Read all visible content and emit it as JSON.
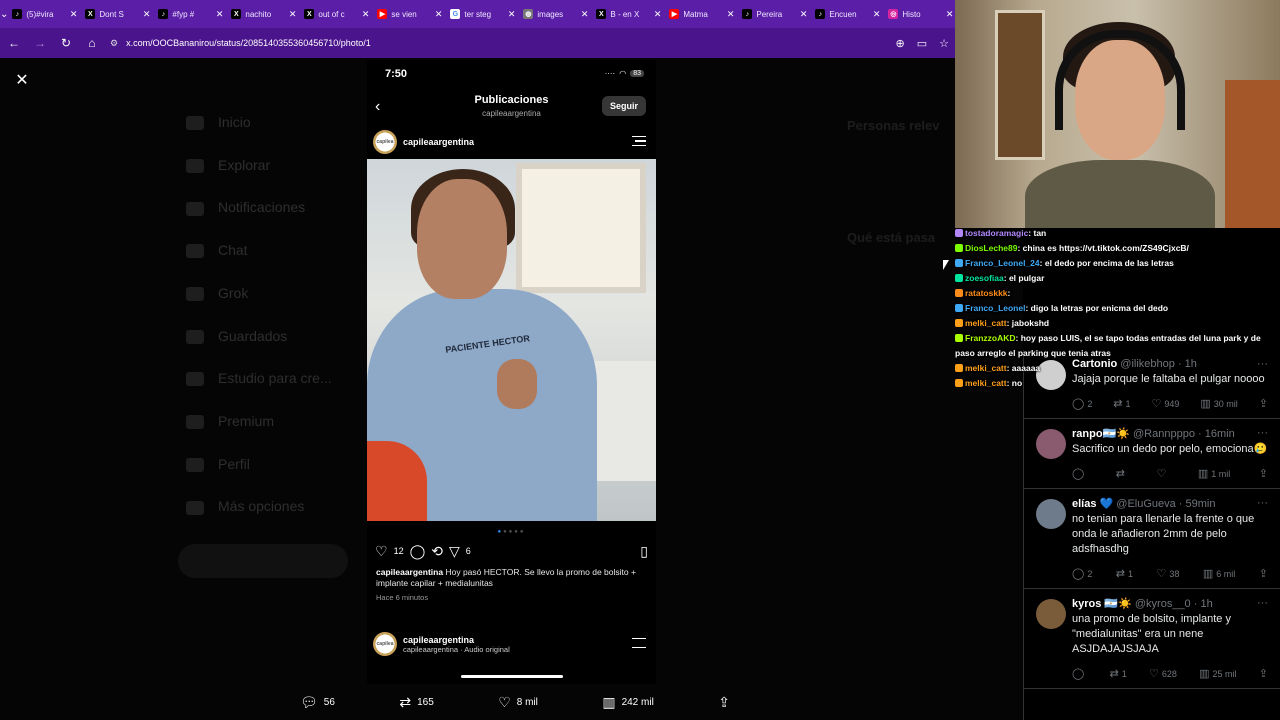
{
  "browser": {
    "tabs": [
      {
        "title": "(5)#vira",
        "icon": "tiktok-icon",
        "color": "#000000"
      },
      {
        "title": "Dont S",
        "icon": "x-icon",
        "color": "#000000"
      },
      {
        "title": "#fyp #",
        "icon": "tiktok-icon",
        "color": "#000000"
      },
      {
        "title": "nachito",
        "icon": "x-icon",
        "color": "#000000"
      },
      {
        "title": "out of c",
        "icon": "x-icon",
        "color": "#000000"
      },
      {
        "title": "se vien",
        "icon": "youtube-icon",
        "color": "#ff0000"
      },
      {
        "title": "ter steg",
        "icon": "google-icon",
        "color": "#ffffff"
      },
      {
        "title": "images",
        "icon": "globe-icon",
        "color": "#777777"
      },
      {
        "title": "B - en X",
        "icon": "x-icon",
        "color": "#000000"
      },
      {
        "title": "Matma",
        "icon": "youtube-icon",
        "color": "#ff0000"
      },
      {
        "title": "Pereira",
        "icon": "tiktok-icon",
        "color": "#000000"
      },
      {
        "title": "Encuen",
        "icon": "tiktok-icon",
        "color": "#000000"
      },
      {
        "title": "Histo",
        "icon": "instagram-icon",
        "color": "#d6249f"
      }
    ],
    "url": "x.com/OOCBananirou/status/2085140355360456710/photo/1"
  },
  "phone": {
    "time": "7:50",
    "battery": "83",
    "header_title": "Publicaciones",
    "header_subtitle": "capileaargentina",
    "follow_label": "Seguir",
    "account": "capileaargentina",
    "shirt_text": "PACIENTE HECTOR",
    "likes": "12",
    "shares": "6",
    "caption_user": "capileaargentina",
    "caption_text": "Hoy pasó HECTOR. Se llevo la promo de bolsito + implante capilar + medialunitas",
    "time_ago": "Hace 6 minutos",
    "next_account": "capileaargentina",
    "next_audio": "capileaargentina · Audio original"
  },
  "post_actions": {
    "replies": "56",
    "reposts": "165",
    "likes": "8 mil",
    "views": "242 mil"
  },
  "replies": [
    {
      "name": "Cartonio",
      "handle": "@ilikebhop · 1h",
      "text": "Jajaja porque le faltaba el pulgar noooo",
      "replies": "2",
      "reposts": "1",
      "likes": "949",
      "views": "30 mil",
      "avatar_color": "#cfcfcf"
    },
    {
      "name": "ranpo🇦🇷☀️",
      "handle": "@Rannpppo · 16min",
      "text": "Sacrifico un dedo por pelo, emociona🥲",
      "replies": "",
      "reposts": "",
      "likes": "",
      "views": "1 mil",
      "avatar_color": "#8a5a6e"
    },
    {
      "name": "elías 💙",
      "handle": "@EluGueva · 59min",
      "text": "no tenian para llenarle la frente o que onda le añadieron 2mm de pelo adsfhasdhg",
      "replies": "2",
      "reposts": "1",
      "likes": "38",
      "views": "6 mil",
      "avatar_color": "#6d7b8a"
    },
    {
      "name": "kyros 🇦🇷☀️",
      "handle": "@kyros__0 · 1h",
      "text": "una promo de bolsito, implante y \"medialunitas\" era un nene ASJDAJAJSJAJA",
      "replies": "",
      "reposts": "1",
      "likes": "628",
      "views": "25 mil",
      "avatar_color": "#7a5b3a"
    }
  ],
  "chat": [
    {
      "user": "tostadoramagic",
      "msg": "tan",
      "color": "#b388ff"
    },
    {
      "user": "DiosLeche89",
      "msg": "china es  https://vt.tiktok.com/ZS49CjxcB/",
      "color": "#7cfc00"
    },
    {
      "user": "Franco_Leonel_24",
      "msg": "el dedo por encima de las letras",
      "color": "#3fa9f5"
    },
    {
      "user": "zoesofiaa",
      "msg": "el pulgar",
      "color": "#00e5a0"
    },
    {
      "user": "ratatoskkk",
      "msg": "",
      "color": "#ff8c1a"
    },
    {
      "user": "Franco_Leonel",
      "msg": "digo la letras por enicma del dedo",
      "color": "#3fa9f5"
    },
    {
      "user": "melki_catt",
      "msg": "jabokshd",
      "color": "#ff9f1a"
    },
    {
      "user": "FranzzoAKD",
      "msg": "hoy paso LUIS, el  se tapo todas entradas del luna park y de paso arreglo el parking que tenia atras",
      "color": "#aaff00"
    },
    {
      "user": "melki_catt",
      "msg": "aaaaaa",
      "color": "#ff9f1a"
    },
    {
      "user": "melki_catt",
      "msg": "no",
      "color": "#ff9f1a"
    }
  ],
  "background_nav": [
    "Inicio",
    "Explorar",
    "Notificaciones",
    "Chat",
    "Grok",
    "Guardados",
    "Estudio para cre...",
    "Premium",
    "Perfil",
    "Más opciones"
  ],
  "colors": {
    "accent": "#5a1fa6",
    "bg": "#000000",
    "muted": "#71767b"
  }
}
